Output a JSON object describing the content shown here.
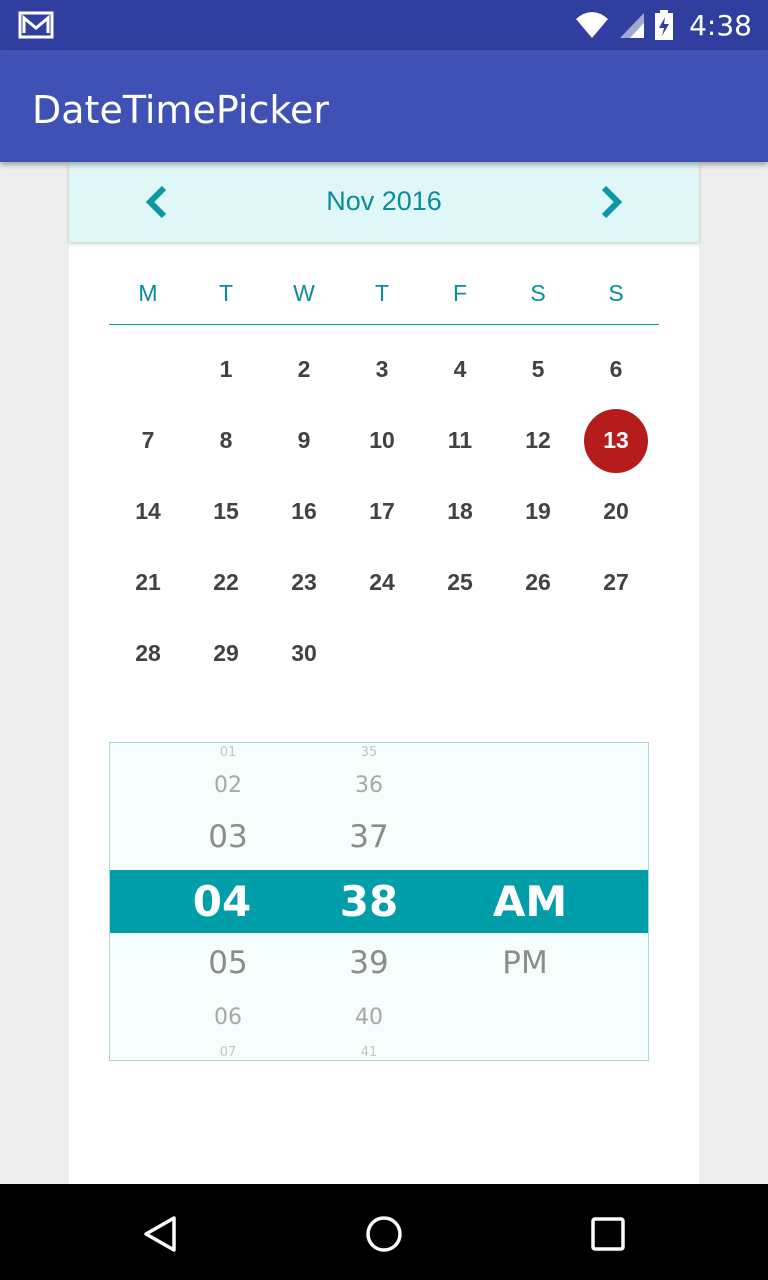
{
  "status_bar": {
    "time": "4:38",
    "icons": [
      "mail-icon",
      "wifi-icon",
      "signal-icon",
      "battery-charging-icon"
    ]
  },
  "app_bar": {
    "title": "DateTimePicker"
  },
  "calendar": {
    "month_label": "Nov 2016",
    "prev_icon": "chevron-left-icon",
    "next_icon": "chevron-right-icon",
    "accent_color": "#0a8c9a",
    "selected_color": "#b71c1c",
    "weekdays": [
      "M",
      "T",
      "W",
      "T",
      "F",
      "S",
      "S"
    ],
    "weeks": [
      [
        "",
        "1",
        "2",
        "3",
        "4",
        "5",
        "6"
      ],
      [
        "7",
        "8",
        "9",
        "10",
        "11",
        "12",
        "13"
      ],
      [
        "14",
        "15",
        "16",
        "17",
        "18",
        "19",
        "20"
      ],
      [
        "21",
        "22",
        "23",
        "24",
        "25",
        "26",
        "27"
      ],
      [
        "28",
        "29",
        "30",
        "",
        "",
        "",
        ""
      ]
    ],
    "selected_day": "13"
  },
  "time_picker": {
    "selection_color": "#009ea9",
    "hours": {
      "above": [
        "01",
        "02",
        "03"
      ],
      "selected": "04",
      "below": [
        "05",
        "06",
        "07"
      ]
    },
    "minutes": {
      "above": [
        "35",
        "36",
        "37"
      ],
      "selected": "38",
      "below": [
        "39",
        "40",
        "41"
      ]
    },
    "ampm": {
      "selected": "AM",
      "below": [
        "PM"
      ]
    }
  },
  "nav_bar": {
    "icons": [
      "back-icon",
      "home-icon",
      "recents-icon"
    ]
  }
}
